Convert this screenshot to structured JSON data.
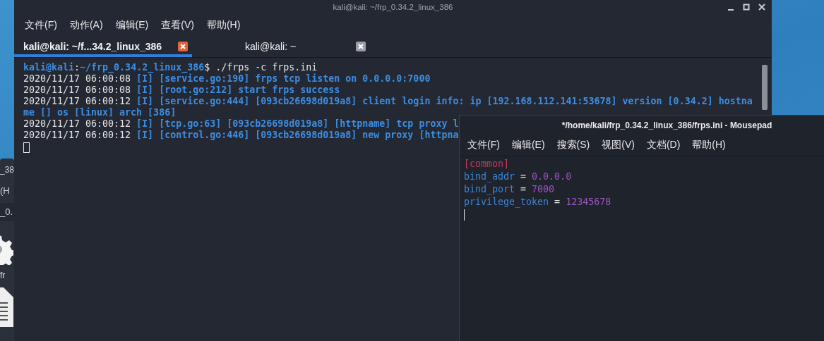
{
  "file_manager": {
    "title": "_38",
    "menu": "(H",
    "path": "_0.",
    "items": [
      {
        "kind": "gear",
        "label": "fr"
      },
      {
        "kind": "file"
      }
    ]
  },
  "terminal": {
    "title": "kali@kali: ~/frp_0.34.2_linux_386",
    "menu": [
      "文件(F)",
      "动作(A)",
      "编辑(E)",
      "查看(V)",
      "帮助(H)"
    ],
    "tabs": [
      {
        "label": "kali@kali: ~/f...34.2_linux_386",
        "selected": true
      },
      {
        "label": "kali@kali: ~",
        "selected": false
      }
    ],
    "lines": [
      [
        {
          "text": "kali@kali",
          "kind": "prompt"
        },
        {
          "text": ":",
          "kind": "plain"
        },
        {
          "text": "~/frp_0.34.2_linux_386",
          "kind": "prompt"
        },
        {
          "text": "$ ./frps -c frps.ini",
          "kind": "plain"
        }
      ],
      [
        {
          "text": "2020/11/17 06:00:08 ",
          "kind": "plain"
        },
        {
          "text": "[I] [service.go:190] frps tcp listen on 0.0.0.0:7000",
          "kind": "log"
        }
      ],
      [
        {
          "text": "2020/11/17 06:00:08 ",
          "kind": "plain"
        },
        {
          "text": "[I] [root.go:212] start frps success",
          "kind": "log"
        }
      ],
      [
        {
          "text": "2020/11/17 06:00:12 ",
          "kind": "plain"
        },
        {
          "text": "[I] [service.go:444] [093cb26698d019a8] client login info: ip [192.168.112.141:53678] version [0.34.2] hostna",
          "kind": "log"
        }
      ],
      [
        {
          "text": "me [] os [linux] arch [386]",
          "kind": "log"
        }
      ],
      [
        {
          "text": "2020/11/17 06:00:12 ",
          "kind": "plain"
        },
        {
          "text": "[I] [tcp.go:63] [093cb26698d019a8] [httpname] tcp proxy l",
          "kind": "log"
        }
      ],
      [
        {
          "text": "2020/11/17 06:00:12 ",
          "kind": "plain"
        },
        {
          "text": "[I] [control.go:446] [093cb26698d019a8] new proxy [httpna",
          "kind": "log"
        }
      ]
    ]
  },
  "editor": {
    "title": "*/home/kali/frp_0.34.2_linux_386/frps.ini - Mousepad",
    "menu": [
      "文件(F)",
      "编辑(E)",
      "搜索(S)",
      "视图(V)",
      "文档(D)",
      "帮助(H)"
    ],
    "lines": [
      [
        {
          "text": "[common]",
          "kind": "section"
        }
      ],
      [
        {
          "text": "bind_addr",
          "kind": "key"
        },
        {
          "text": " = ",
          "kind": "op"
        },
        {
          "text": "0.0.0.0",
          "kind": "value"
        }
      ],
      [
        {
          "text": "bind_port",
          "kind": "key"
        },
        {
          "text": " = ",
          "kind": "op"
        },
        {
          "text": "7000",
          "kind": "value"
        }
      ],
      [
        {
          "text": "privilege_token",
          "kind": "key"
        },
        {
          "text": " = ",
          "kind": "op"
        },
        {
          "text": "12345678",
          "kind": "value"
        }
      ]
    ]
  }
}
